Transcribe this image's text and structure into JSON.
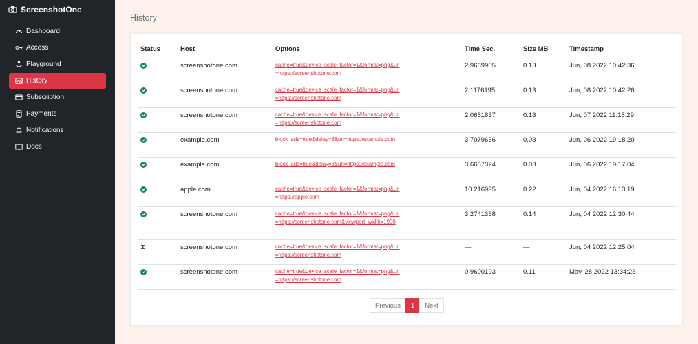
{
  "brand": {
    "name": "ScreenshotOne"
  },
  "sidebar": {
    "items": [
      {
        "label": "Dashboard",
        "icon": "speedometer-icon"
      },
      {
        "label": "Access",
        "icon": "key-icon"
      },
      {
        "label": "Playground",
        "icon": "anchor-icon"
      },
      {
        "label": "History",
        "icon": "images-icon",
        "active": true
      },
      {
        "label": "Subscription",
        "icon": "card-icon"
      },
      {
        "label": "Payments",
        "icon": "receipt-icon"
      },
      {
        "label": "Notifications",
        "icon": "bell-icon"
      },
      {
        "label": "Docs",
        "icon": "book-icon"
      }
    ]
  },
  "page": {
    "title": "History"
  },
  "table": {
    "headers": [
      "Status",
      "Host",
      "Options",
      "Time Sec.",
      "Size MB",
      "Timestamp"
    ],
    "rows": [
      {
        "status": "success",
        "host": "screenshotone.com",
        "options": "cache=true&device_scale_factor=1&format=png&url=https://screenshotone.com",
        "time": "2.9669905",
        "size": "0.13",
        "timestamp": "Jun, 08 2022 10:42:36"
      },
      {
        "status": "success",
        "host": "screenshotone.com",
        "options": "cache=true&device_scale_factor=1&format=png&url=https://screenshotone.com",
        "time": "2.1176195",
        "size": "0.13",
        "timestamp": "Jun, 08 2022 10:42:26"
      },
      {
        "status": "success",
        "host": "screenshotone.com",
        "options": "cache=true&device_scale_factor=1&format=png&url=https://screenshotone.com",
        "time": "2.0681837",
        "size": "0.13",
        "timestamp": "Jun, 07 2022 11:18:29"
      },
      {
        "status": "success",
        "host": "example.com",
        "options": "block_ads=true&delay=3&url=https://example.com",
        "time": "3.7079656",
        "size": "0.03",
        "timestamp": "Jun, 06 2022 19:18:20"
      },
      {
        "status": "success",
        "host": "example.com",
        "options": "block_ads=true&delay=3&url=https://example.com",
        "time": "3.6657324",
        "size": "0.03",
        "timestamp": "Jun, 06 2022 19:17:04"
      },
      {
        "status": "success",
        "host": "apple.com",
        "options": "cache=true&device_scale_factor=1&format=png&url=https://apple.com",
        "time": "10.216995",
        "size": "0.22",
        "timestamp": "Jun, 04 2022 16:13:19"
      },
      {
        "status": "success",
        "host": "screenshotone.com",
        "options": "cache=true&device_scale_factor=1&format=png&url=https://screenshotone.com&viewport_width=1900",
        "time": "3.2741358",
        "size": "0.14",
        "timestamp": "Jun, 04 2022 12:30:44"
      },
      {
        "status": "pending",
        "host": "screenshotone.com",
        "options": "cache=true&device_scale_factor=1&format=png&url=https://screenshotone.com",
        "time": "—",
        "size": "—",
        "timestamp": "Jun, 04 2022 12:25:04"
      },
      {
        "status": "success",
        "host": "screenshotone.com",
        "options": "cache=true&device_scale_factor=1&format=png&url=https://screenshotone.com",
        "time": "0.9600193",
        "size": "0.11",
        "timestamp": "May, 28 2022 13:34:23"
      }
    ]
  },
  "pagination": {
    "previous": "Previous",
    "current": "1",
    "next": "Next"
  },
  "colors": {
    "accent": "#dc3545",
    "sidebar_bg": "#212529",
    "success": "#198754",
    "page_bg": "#fdf3ec"
  }
}
